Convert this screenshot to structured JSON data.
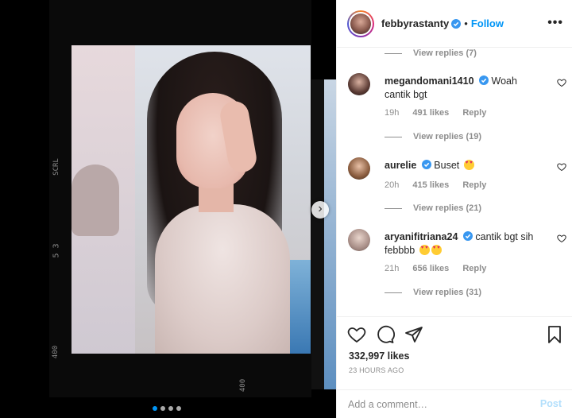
{
  "post": {
    "username": "febbyrastanty",
    "follow_label": "Follow",
    "dot": "•",
    "more_icon": "more-horizontal-icon",
    "more_label": "•••"
  },
  "media": {
    "film_marks": [
      "SCRL",
      "5 3",
      "400",
      "400"
    ],
    "carousel_next": "›",
    "dots": 4,
    "active_dot": 0
  },
  "comments": {
    "replies_top": "View replies (7)",
    "items": [
      {
        "user": "megandomani1410",
        "text": "Woah cantik bgt",
        "time": "19h",
        "likes": "491 likes",
        "reply": "Reply",
        "replies": "View replies (19)"
      },
      {
        "user": "aurelie",
        "text": "Buset",
        "time": "20h",
        "likes": "415 likes",
        "reply": "Reply",
        "replies": "View replies (21)"
      },
      {
        "user": "aryanifitriana24",
        "text": "cantik bgt sih febbbb",
        "time": "21h",
        "likes": "656 likes",
        "reply": "Reply",
        "replies": "View replies (31)"
      }
    ]
  },
  "footer": {
    "likes": "332,997 likes",
    "time": "23 HOURS AGO",
    "comment_placeholder": "Add a comment…",
    "post_label": "Post"
  },
  "colors": {
    "accent": "#0095f6",
    "verified": "#3897f0",
    "muted": "#8e8e8e",
    "text": "#262626"
  }
}
